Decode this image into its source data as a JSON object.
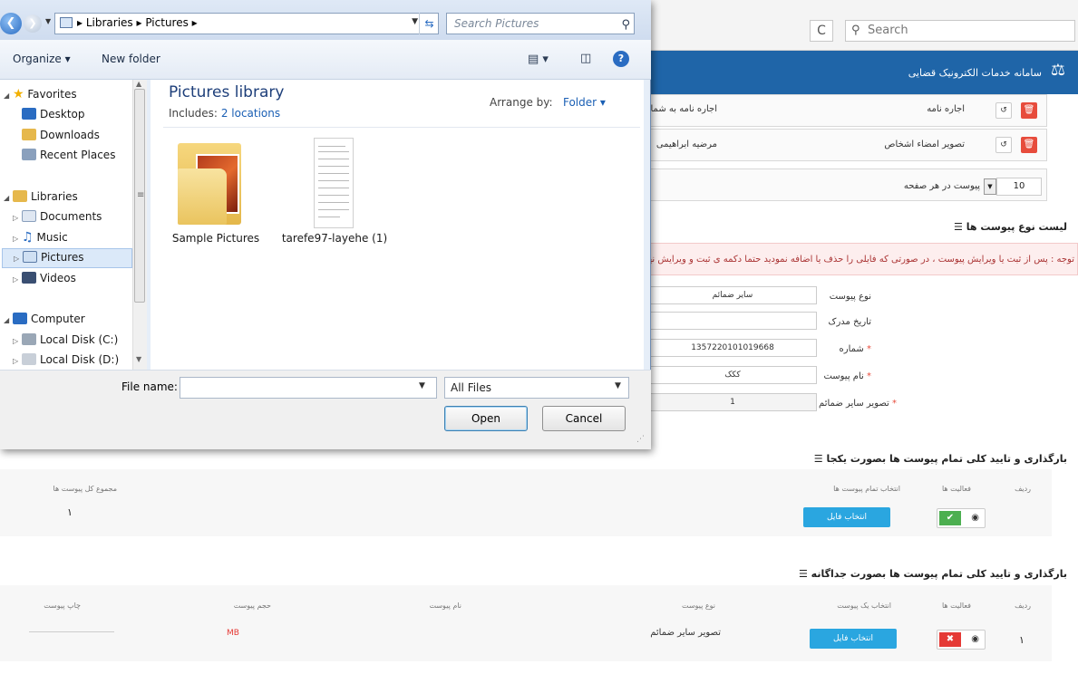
{
  "browser": {
    "search_placeholder": "Search",
    "refresh_icon": "C"
  },
  "site": {
    "title": "سامانه خدمات الکترونیک قضایی"
  },
  "attachments_top": [
    {
      "title": "اجاره نامه",
      "desc": "اجاره نامه به شما"
    },
    {
      "title": "تصویر امضاء اشخاص",
      "desc": "مرضیه ابراهیمی"
    }
  ],
  "pagination": {
    "per_page_label": "پیوست در هر صفحه",
    "per_page_value": "10"
  },
  "attachment_types": {
    "title": "لیست نوع پیوست ها",
    "note": "توجه : پس از ثبت یا ویرایش پیوست ، در صورتی که فایلی را حذف یا اضافه نمودید حتما دکمه ی ثبت و ویرایش نهایی",
    "fields": [
      {
        "label": "نوع پیوست",
        "value": "سایر ضمائم",
        "required": false
      },
      {
        "label": "تاریخ مدرک",
        "value": "",
        "required": false
      },
      {
        "label": "شماره",
        "value": "1357220101019668",
        "required": true
      },
      {
        "label": "نام پیوست",
        "value": "ککک",
        "required": true
      },
      {
        "label": "تصویر سایر ضمائم",
        "value": "1",
        "required": true
      }
    ]
  },
  "upload_all": {
    "title": "بارگذاری و تایید کلی تمام پیوست ها بصورت یکجا",
    "headers": {
      "row": "ردیف",
      "actions": "فعالیت ها",
      "select_all": "انتخاب تمام پیوست ها",
      "total": "مجموع کل پیوست ها"
    },
    "total_value": "١",
    "select_button": "انتخاب فایل"
  },
  "upload_each": {
    "title": "بارگذاری و تایید کلی تمام پیوست ها بصورت جداگانه",
    "headers": {
      "row": "ردیف",
      "actions": "فعالیت ها",
      "select_one": "انتخاب یک پیوست",
      "type": "نوع پیوست",
      "name": "نام پیوست",
      "size": "حجم پیوست",
      "print": "چاپ پیوست"
    },
    "row": {
      "index": "١",
      "type": "تصویر سایر ضمائم",
      "size": "MB"
    },
    "select_button": "انتخاب فایل"
  },
  "dialog": {
    "breadcrumbs": [
      "Libraries",
      "Pictures"
    ],
    "search_placeholder": "Search Pictures",
    "toolbar": {
      "organize": "Organize ▾",
      "new_folder": "New folder"
    },
    "nav": {
      "favorites": "Favorites",
      "favorites_items": [
        "Desktop",
        "Downloads",
        "Recent Places"
      ],
      "libraries": "Libraries",
      "libraries_items": [
        "Documents",
        "Music",
        "Pictures",
        "Videos"
      ],
      "computer": "Computer",
      "computer_items": [
        "Local Disk (C:)",
        "Local Disk (D:)"
      ]
    },
    "library_title": "Pictures library",
    "includes_label": "Includes:",
    "includes_link": "2 locations",
    "arrange_label": "Arrange by:",
    "arrange_value": "Folder ▾",
    "files": [
      {
        "name": "Sample Pictures",
        "kind": "folder"
      },
      {
        "name": "tarefe97-layehe (1)",
        "kind": "document"
      }
    ],
    "file_name_label": "File name:",
    "file_name_value": "",
    "filter_value": "All Files",
    "open_button": "Open",
    "cancel_button": "Cancel"
  },
  "colors": {
    "site_header": "#1f65a8",
    "select_button": "#2aa6e0",
    "delete_red": "#e74c3c",
    "confirm_green": "#4caf50"
  }
}
